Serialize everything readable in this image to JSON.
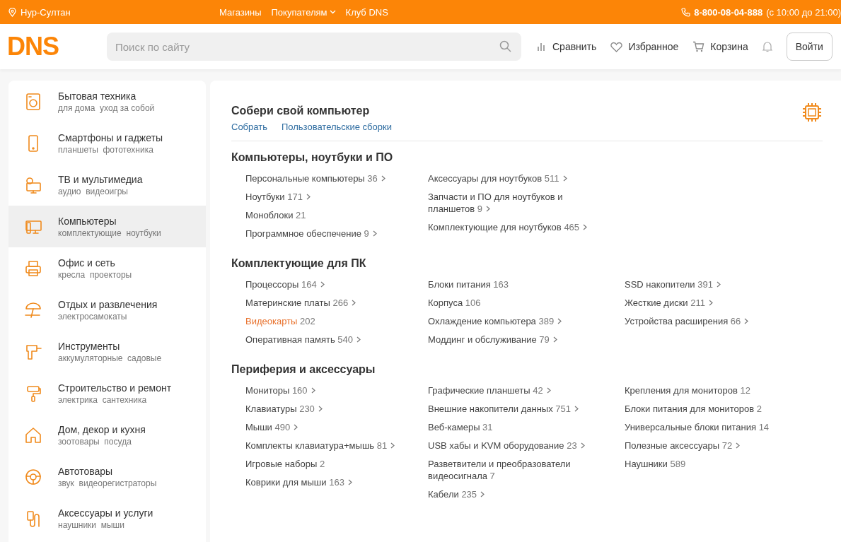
{
  "top_bar": {
    "city": "Нур-Султан",
    "links": [
      {
        "label": "Магазины",
        "dropdown": false
      },
      {
        "label": "Покупателям",
        "dropdown": true
      },
      {
        "label": "Клуб DNS",
        "dropdown": false
      }
    ],
    "phone": "8-800-08-04-888",
    "hours": "(с 10:00 до 21:00)"
  },
  "header": {
    "logo": "DNS",
    "search": {
      "placeholder": "Поиск по сайту"
    },
    "nav": [
      "Сравнить",
      "Избранное",
      "Корзина"
    ],
    "login": "Войти"
  },
  "sidebar": {
    "items": [
      {
        "title": "Бытовая техника",
        "tags": [
          "для дома",
          "уход за собой"
        ],
        "selected": false
      },
      {
        "title": "Смартфоны и гаджеты",
        "tags": [
          "планшеты",
          "фототехника"
        ],
        "selected": false
      },
      {
        "title": "ТВ и мультимедиа",
        "tags": [
          "аудио",
          "видеоигры"
        ],
        "selected": false
      },
      {
        "title": "Компьютеры",
        "tags": [
          "комплектующие",
          "ноутбуки"
        ],
        "selected": true
      },
      {
        "title": "Офис и сеть",
        "tags": [
          "кресла",
          "проекторы"
        ],
        "selected": false
      },
      {
        "title": "Отдых и развлечения",
        "tags": [
          "электросамокаты"
        ],
        "selected": false
      },
      {
        "title": "Инструменты",
        "tags": [
          "аккумуляторные",
          "садовые"
        ],
        "selected": false
      },
      {
        "title": "Строительство и ремонт",
        "tags": [
          "электрика",
          "сантехника"
        ],
        "selected": false
      },
      {
        "title": "Дом, декор и кухня",
        "tags": [
          "зоотовары",
          "посуда"
        ],
        "selected": false
      },
      {
        "title": "Автотовары",
        "tags": [
          "звук",
          "видеорегистраторы"
        ],
        "selected": false
      },
      {
        "title": "Аксессуары и услуги",
        "tags": [
          "наушники",
          "мыши"
        ],
        "selected": false
      }
    ]
  },
  "builder": {
    "title": "Собери свой компьютер",
    "links": [
      "Собрать",
      "Пользовательские сборки"
    ]
  },
  "sections": [
    {
      "title": "Компьютеры, ноутбуки и ПО",
      "columns": [
        [
          {
            "name": "Персональные компьютеры",
            "count": "36",
            "has_submenu": true,
            "selected": false
          },
          {
            "name": "Ноутбуки",
            "count": "171",
            "has_submenu": true,
            "selected": false
          },
          {
            "name": "Моноблоки",
            "count": "21",
            "has_submenu": false,
            "selected": false
          },
          {
            "name": "Программное обеспечение",
            "count": "9",
            "has_submenu": true,
            "selected": false
          }
        ],
        [
          {
            "name": "Аксессуары для ноутбуков",
            "count": "511",
            "has_submenu": true,
            "selected": false
          },
          {
            "name": "Запчасти и ПО для ноутбуков и планшетов",
            "count": "9",
            "has_submenu": true,
            "selected": false
          },
          {
            "name": "Комплектующие для ноутбуков",
            "count": "465",
            "has_submenu": true,
            "selected": false
          }
        ]
      ]
    },
    {
      "title": "Комплектующие для ПК",
      "columns": [
        [
          {
            "name": "Процессоры",
            "count": "164",
            "has_submenu": true,
            "selected": false
          },
          {
            "name": "Материнские платы",
            "count": "266",
            "has_submenu": true,
            "selected": false
          },
          {
            "name": "Видеокарты",
            "count": "202",
            "has_submenu": false,
            "selected": true
          },
          {
            "name": "Оперативная память",
            "count": "540",
            "has_submenu": true,
            "selected": false
          }
        ],
        [
          {
            "name": "Блоки питания",
            "count": "163",
            "has_submenu": false,
            "selected": false
          },
          {
            "name": "Корпуса",
            "count": "106",
            "has_submenu": false,
            "selected": false
          },
          {
            "name": "Охлаждение компьютера",
            "count": "389",
            "has_submenu": true,
            "selected": false
          },
          {
            "name": "Моддинг и обслуживание",
            "count": "79",
            "has_submenu": true,
            "selected": false
          }
        ],
        [
          {
            "name": "SSD накопители",
            "count": "391",
            "has_submenu": true,
            "selected": false
          },
          {
            "name": "Жесткие диски",
            "count": "211",
            "has_submenu": true,
            "selected": false
          },
          {
            "name": "Устройства расширения",
            "count": "66",
            "has_submenu": true,
            "selected": false
          }
        ]
      ]
    },
    {
      "title": "Периферия и аксессуары",
      "columns": [
        [
          {
            "name": "Мониторы",
            "count": "160",
            "has_submenu": true,
            "selected": false
          },
          {
            "name": "Клавиатуры",
            "count": "230",
            "has_submenu": true,
            "selected": false
          },
          {
            "name": "Мыши",
            "count": "490",
            "has_submenu": true,
            "selected": false
          },
          {
            "name": "Комплекты клавиатура+мышь",
            "count": "81",
            "has_submenu": true,
            "selected": false
          },
          {
            "name": "Игровые наборы",
            "count": "2",
            "has_submenu": false,
            "selected": false
          },
          {
            "name": "Коврики для мыши",
            "count": "163",
            "has_submenu": true,
            "selected": false
          }
        ],
        [
          {
            "name": "Графические планшеты",
            "count": "42",
            "has_submenu": true,
            "selected": false
          },
          {
            "name": "Внешние накопители данных",
            "count": "751",
            "has_submenu": true,
            "selected": false
          },
          {
            "name": "Веб-камеры",
            "count": "31",
            "has_submenu": false,
            "selected": false
          },
          {
            "name": "USB хабы и KVM оборудование",
            "count": "23",
            "has_submenu": true,
            "selected": false
          },
          {
            "name": "Разветвители и преобразователи видеосигнала",
            "count": "7",
            "has_submenu": false,
            "selected": false
          },
          {
            "name": "Кабели",
            "count": "235",
            "has_submenu": true,
            "selected": false
          }
        ],
        [
          {
            "name": "Крепления для мониторов",
            "count": "12",
            "has_submenu": false,
            "selected": false
          },
          {
            "name": "Блоки питания для мониторов",
            "count": "2",
            "has_submenu": false,
            "selected": false
          },
          {
            "name": "Универсальные блоки питания",
            "count": "14",
            "has_submenu": false,
            "selected": false
          },
          {
            "name": "Полезные аксессуары",
            "count": "72",
            "has_submenu": true,
            "selected": false
          },
          {
            "name": "Наушники",
            "count": "589",
            "has_submenu": false,
            "selected": false
          }
        ]
      ]
    }
  ]
}
